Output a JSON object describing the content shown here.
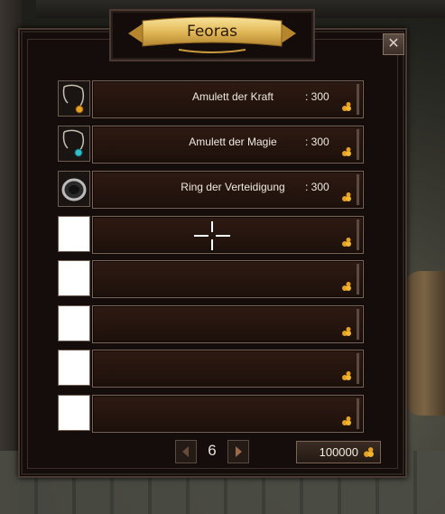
{
  "window": {
    "title": "Feoras",
    "close_label": "✕"
  },
  "items": [
    {
      "name": "Amulett der Kraft",
      "price": ": 300",
      "icon": "amulet-gold-icon"
    },
    {
      "name": "Amulett der Magie",
      "price": ": 300",
      "icon": "amulet-blue-icon"
    },
    {
      "name": "Ring der Verteidigung",
      "price": ": 300",
      "icon": "ring-icon"
    },
    {
      "name": "",
      "price": "",
      "icon": "empty-slot"
    },
    {
      "name": "",
      "price": "",
      "icon": "empty-slot"
    },
    {
      "name": "",
      "price": "",
      "icon": "empty-slot"
    },
    {
      "name": "",
      "price": "",
      "icon": "empty-slot"
    },
    {
      "name": "",
      "price": "",
      "icon": "empty-slot"
    }
  ],
  "pagination": {
    "page": "6"
  },
  "wallet": {
    "gold": "100000"
  },
  "colors": {
    "panel": "#140d0b",
    "row": "#2a1710",
    "border": "#7a6456",
    "text": "#eeeae4",
    "gold": "#e8a020"
  }
}
